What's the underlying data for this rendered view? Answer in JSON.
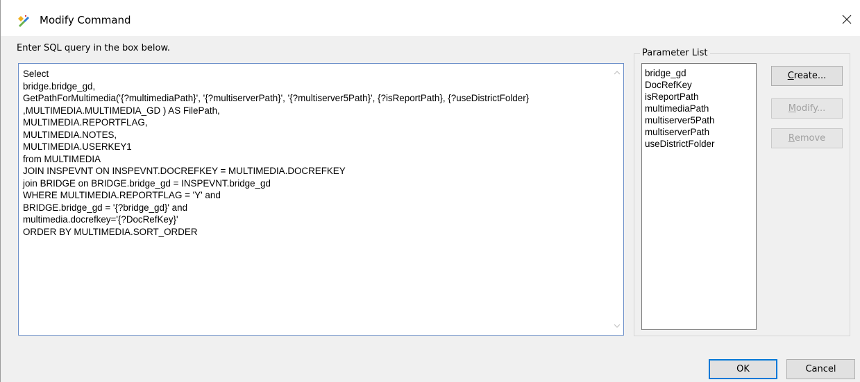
{
  "window": {
    "title": "Modify Command",
    "icon": "command-edit-icon",
    "close_icon": "close-icon"
  },
  "editor": {
    "hint": "Enter SQL query in the box below.",
    "query_lines": [
      "Select",
      "bridge.bridge_gd,",
      "GetPathForMultimedia('{?multimediaPath}', '{?multiserverPath}', '{?multiserver5Path}', {?isReportPath}, {?useDistrictFolder}",
      ",MULTIMEDIA.MULTIMEDIA_GD ) AS FilePath,",
      "MULTIMEDIA.REPORTFLAG,",
      "MULTIMEDIA.NOTES,",
      "MULTIMEDIA.USERKEY1",
      "from MULTIMEDIA",
      "JOIN INSPEVNT ON INSPEVNT.DOCREFKEY = MULTIMEDIA.DOCREFKEY",
      "join BRIDGE on BRIDGE.bridge_gd = INSPEVNT.bridge_gd",
      "WHERE MULTIMEDIA.REPORTFLAG = 'Y' and",
      "BRIDGE.bridge_gd = '{?bridge_gd}' and",
      "multimedia.docrefkey='{?DocRefKey}'",
      "ORDER BY MULTIMEDIA.SORT_ORDER"
    ]
  },
  "parameters": {
    "legend": "Parameter List",
    "items": [
      "bridge_gd",
      "DocRefKey",
      "isReportPath",
      "multimediaPath",
      "multiserver5Path",
      "multiserverPath",
      "useDistrictFolder"
    ],
    "create_first": "C",
    "create_rest": "reate...",
    "modify_first": "M",
    "modify_rest": "odify...",
    "remove_first": "R",
    "remove_rest": "emove"
  },
  "footer": {
    "ok_label": "OK",
    "cancel_label": "Cancel"
  }
}
